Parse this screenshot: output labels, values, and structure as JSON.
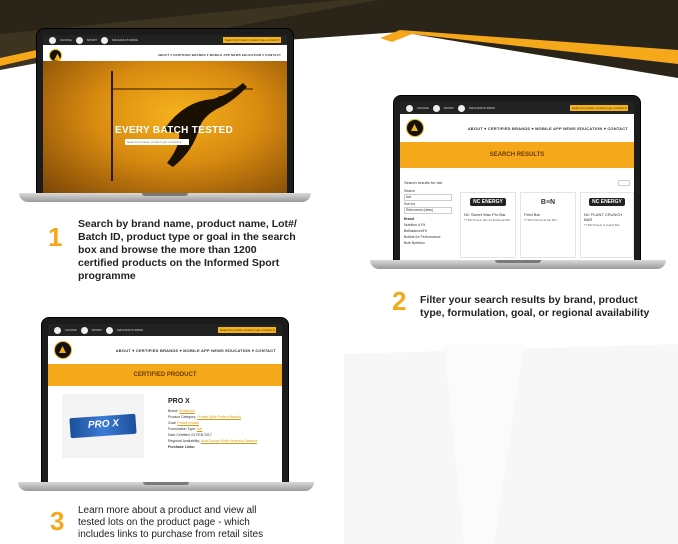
{
  "colors": {
    "accent": "#f5a91a",
    "dark": "#1b1b1b"
  },
  "shared": {
    "topbar_items": [
      "INFORMED",
      "CHOICE",
      "SPORT",
      "MANUFACTURING",
      "INGREDIENTS"
    ],
    "search_placeholder": "Search by brand, product type or batch #",
    "nav_links": "ABOUT ▾  CERTIFIED BRANDS ▾  MOBILE APP  NEWS  EDUCATION ▾  CONTACT",
    "logo_text": "SPORT"
  },
  "laptop1": {
    "hero_title": "EVERY BATCH TESTED",
    "hero_search_placeholder": "Search by brand, product type or batch #"
  },
  "laptop2": {
    "banner": "SEARCH RESULTS",
    "search_label": "Search results for bar",
    "filter_labels": [
      "Search",
      "bar",
      "Sort by",
      "Relevance (desc)",
      "Brand",
      "Nutrition & Fit",
      "BeBalancedFit",
      "Bullets for Performance",
      "Bulk Nutrition"
    ],
    "cards": [
      {
        "brand": "NC ENERGY",
        "name": "NC Sweet Wax Pro Bar",
        "meta": "TYPE Protein Bar & Nutritional Bar"
      },
      {
        "brand": "B≡N",
        "name": "Field Bar",
        "meta": "TYPE Nutritional bar Bar"
      },
      {
        "brand": "NC ENERGY",
        "name": "NC PLANT CRUNCH BAR",
        "meta": "TYPE Protein & Snack Bar"
      }
    ]
  },
  "laptop3": {
    "banner": "CERTIFIED PRODUCT",
    "product_name": "PRO X",
    "product_image_label": "PRO X",
    "fields": [
      {
        "label": "Brand:",
        "value": "Bodybuild"
      },
      {
        "label": "Product Category:",
        "value": "Protein (Milk Protein Based)"
      },
      {
        "label": "Goal:",
        "value": "Protein Intake"
      },
      {
        "label": "Formulation Type:",
        "value": "Bar"
      },
      {
        "label": "Date Certified:",
        "value": "01 FEB 2017"
      },
      {
        "label": "Regional Availability:",
        "value": "Asia   Europe   North America   Oceania"
      },
      {
        "label": "Purchase Links:",
        "value": ""
      }
    ]
  },
  "steps": [
    {
      "num": "1",
      "text": "Search by brand name, product name, Lot#/ Batch ID, product type or goal in the search box and browse the more than 1200 certified products on the Informed Sport programme"
    },
    {
      "num": "2",
      "text": "Filter your search results by brand, product type, formulation, goal, or regional availability"
    },
    {
      "num": "3",
      "text": "Learn more about a product and view all tested lots on the product page - which includes links to purchase from retail sites"
    }
  ]
}
